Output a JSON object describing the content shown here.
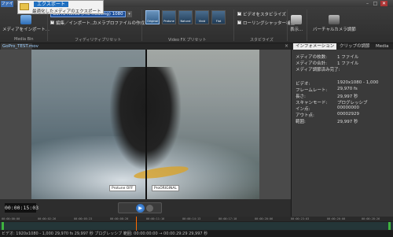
{
  "app": {
    "menu_label": "ファイル"
  },
  "export_menu": {
    "title": "エクスポート",
    "item": "最適化したメディアのエクスポート"
  },
  "ribbon": {
    "media_import_label": "メディアをインポート...",
    "media_bin_label": "Media Bin",
    "project_preset": "GoPro Hero3 (Pro-Housing) 1080",
    "edit_import_label": "編集／インポート...",
    "camera_profile_label": "カメラプロファイルの作成",
    "fidelity_group_label": "フィディリティプリセット",
    "preset_group_label": "Video FX プリセット",
    "presets": [
      "Original",
      "Protune",
      "Natural",
      "Vivid",
      "Flat"
    ],
    "stabilize_label": "ビデオをスタビライズ",
    "rolling_shutter_label": "ローリングシャッター補正",
    "stabilize_group_label": "スタビライズ",
    "display_label": "表示...",
    "virtual_camera_label": "バーチャルカメラ調節"
  },
  "viewer": {
    "file_tab": "GoPro_TEST.mov",
    "tag_left": "Protune OFF",
    "tag_right": "ProORIGINAL",
    "timecode": "00:00:15:03"
  },
  "right_panel": {
    "tabs": [
      "インフォメーション",
      "クリップの調節",
      "Media"
    ],
    "info_top": [
      {
        "label": "メディアの枚数:",
        "value": "1 ファイル"
      },
      {
        "label": "メディアの合計:",
        "value": "1 ファイル"
      },
      {
        "label": "メディア調節済み完了:",
        "value": ""
      }
    ],
    "info_bottom": [
      {
        "label": "ビデオ:",
        "value": "1920x1080 - 1,000"
      },
      {
        "label": "フレームレート:",
        "value": "29,970 fs"
      },
      {
        "label": "長さ:",
        "value": "29,997 秒"
      },
      {
        "label": "スキャンモード:",
        "value": "プログレッシブ"
      },
      {
        "label": "イン点:",
        "value": "00000000"
      },
      {
        "label": "アウト点:",
        "value": "00002929"
      },
      {
        "label": "範囲:",
        "value": "29,997 秒"
      }
    ]
  },
  "timeline": {
    "ticks": [
      "00:00:00:00",
      "00:00:02:26",
      "00:00:05:23",
      "00:00:08:20",
      "00:00:11:16",
      "00:00:14:13",
      "00:00:17:10",
      "00:00:20:06",
      "00:00:23:03",
      "00:00:26:00",
      "00:00:28:26"
    ]
  },
  "status": {
    "text": "ビデオ: 1920x1080 - 1,000  29,970 fs  29,997 秒  プログレッシブ  範囲: 00:00:00:00 → 00:00:29:29  29,997 秒"
  },
  "colors": {
    "accent": "#1f6fc0",
    "playhead": "#ff6a00",
    "in_out": "#3fb33f"
  }
}
